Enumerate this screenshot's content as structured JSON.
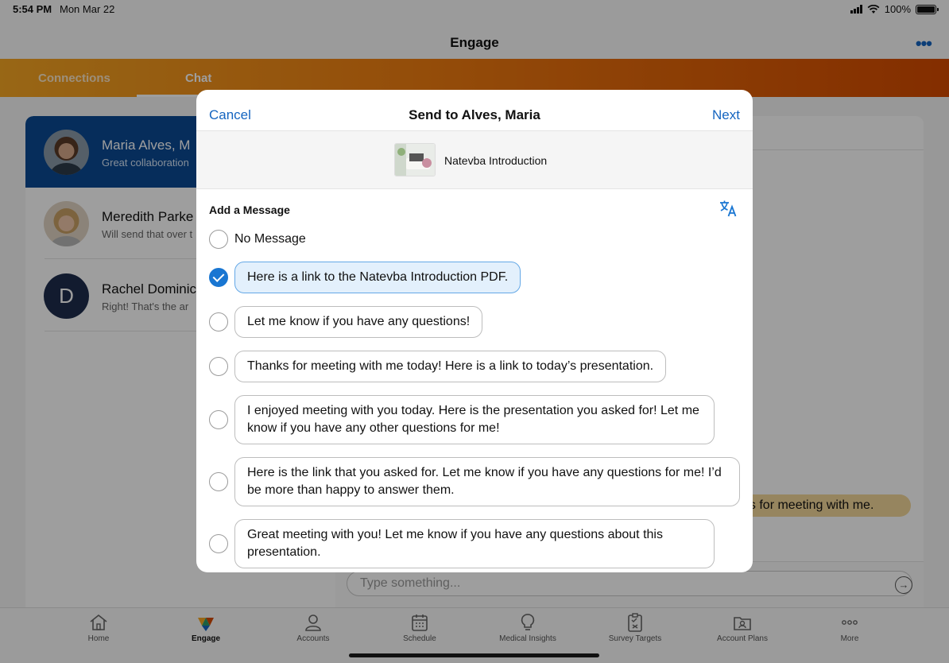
{
  "status": {
    "time": "5:54 PM",
    "date": "Mon Mar 22",
    "battery": "100%"
  },
  "nav": {
    "title": "Engage"
  },
  "tabs": [
    {
      "label": "Connections"
    },
    {
      "label": "Chat"
    }
  ],
  "contacts": [
    {
      "name": "Maria Alves, M",
      "preview": "Great collaboration"
    },
    {
      "name": "Meredith Parke",
      "preview": "Will send that over t"
    },
    {
      "name": "Rachel Dominic",
      "preview": "Right! That's the ar",
      "initial": "D"
    }
  ],
  "chat": {
    "bubble_text": "nks for meeting with me.",
    "composer_placeholder": "Type something..."
  },
  "modal": {
    "cancel": "Cancel",
    "title": "Send to Alves, Maria",
    "next": "Next",
    "attachment": "Natevba Introduction",
    "add_message_label": "Add a Message",
    "no_message": "No Message",
    "messages": [
      "Here is a link to the Natevba Introduction PDF.",
      "Let me know if you have any questions!",
      "Thanks for meeting with me today! Here is a link to today’s presentation.",
      "I enjoyed meeting with you today. Here is the presentation you asked for! Let me know if you have any other questions for me!",
      "Here is the link that you asked for. Let me know if you have any questions for me! I’d be more than happy to answer them.",
      "Great meeting with you! Let me know if you have any questions about this presentation."
    ],
    "selected_index": 0
  },
  "bottom_nav": [
    {
      "label": "Home",
      "icon": "home-icon"
    },
    {
      "label": "Engage",
      "icon": "engage-icon",
      "active": true
    },
    {
      "label": "Accounts",
      "icon": "accounts-icon"
    },
    {
      "label": "Schedule",
      "icon": "calendar-icon"
    },
    {
      "label": "Medical Insights",
      "icon": "lightbulb-icon"
    },
    {
      "label": "Survey Targets",
      "icon": "clipboard-icon"
    },
    {
      "label": "Account Plans",
      "icon": "folder-icon"
    },
    {
      "label": "More",
      "icon": "more-icon"
    }
  ],
  "colors": {
    "accent": "#1565c0",
    "selected": "#0a4a94",
    "tab_start": "#f5a623",
    "tab_end": "#d44a00"
  }
}
